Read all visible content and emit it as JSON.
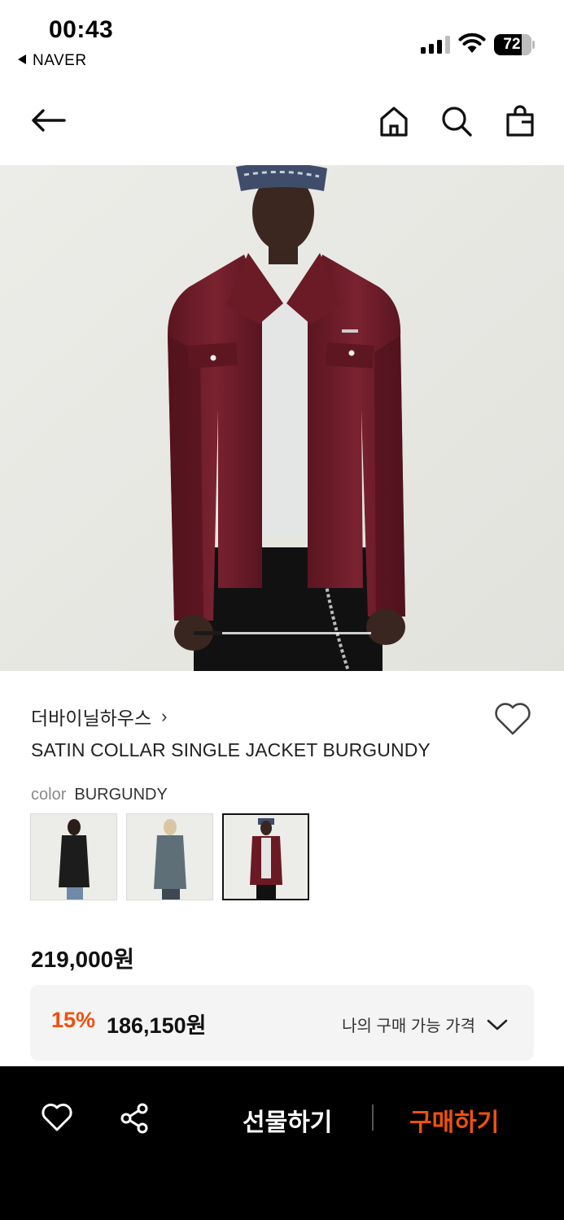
{
  "status_bar": {
    "time": "00:43",
    "back_app": "NAVER",
    "battery": "72"
  },
  "header": {
    "icons": [
      "back-arrow-icon",
      "home-icon",
      "search-icon",
      "shopping-bag-icon"
    ]
  },
  "hero": {
    "image_subject": "model wearing burgundy satin jacket",
    "slider_progress": 0.16
  },
  "product": {
    "brand": "더바이닐하우스",
    "name": "SATIN COLLAR SINGLE JACKET BURGUNDY",
    "color_label": "color",
    "color_value": "BURGUNDY",
    "swatches": [
      {
        "color": "black",
        "selected": false
      },
      {
        "color": "denim",
        "selected": false
      },
      {
        "color": "burgundy",
        "selected": true
      }
    ],
    "price": "219,000원",
    "discount_rate": "15%",
    "discount_price": "186,150원",
    "my_price_label": "나의 구매 가능 가격"
  },
  "bottom_bar": {
    "gift_label": "선물하기",
    "buy_label": "구매하기"
  },
  "colors": {
    "accent": "#f0500e",
    "bottom_bar_bg": "#000000",
    "jacket": "#6b1a24"
  }
}
